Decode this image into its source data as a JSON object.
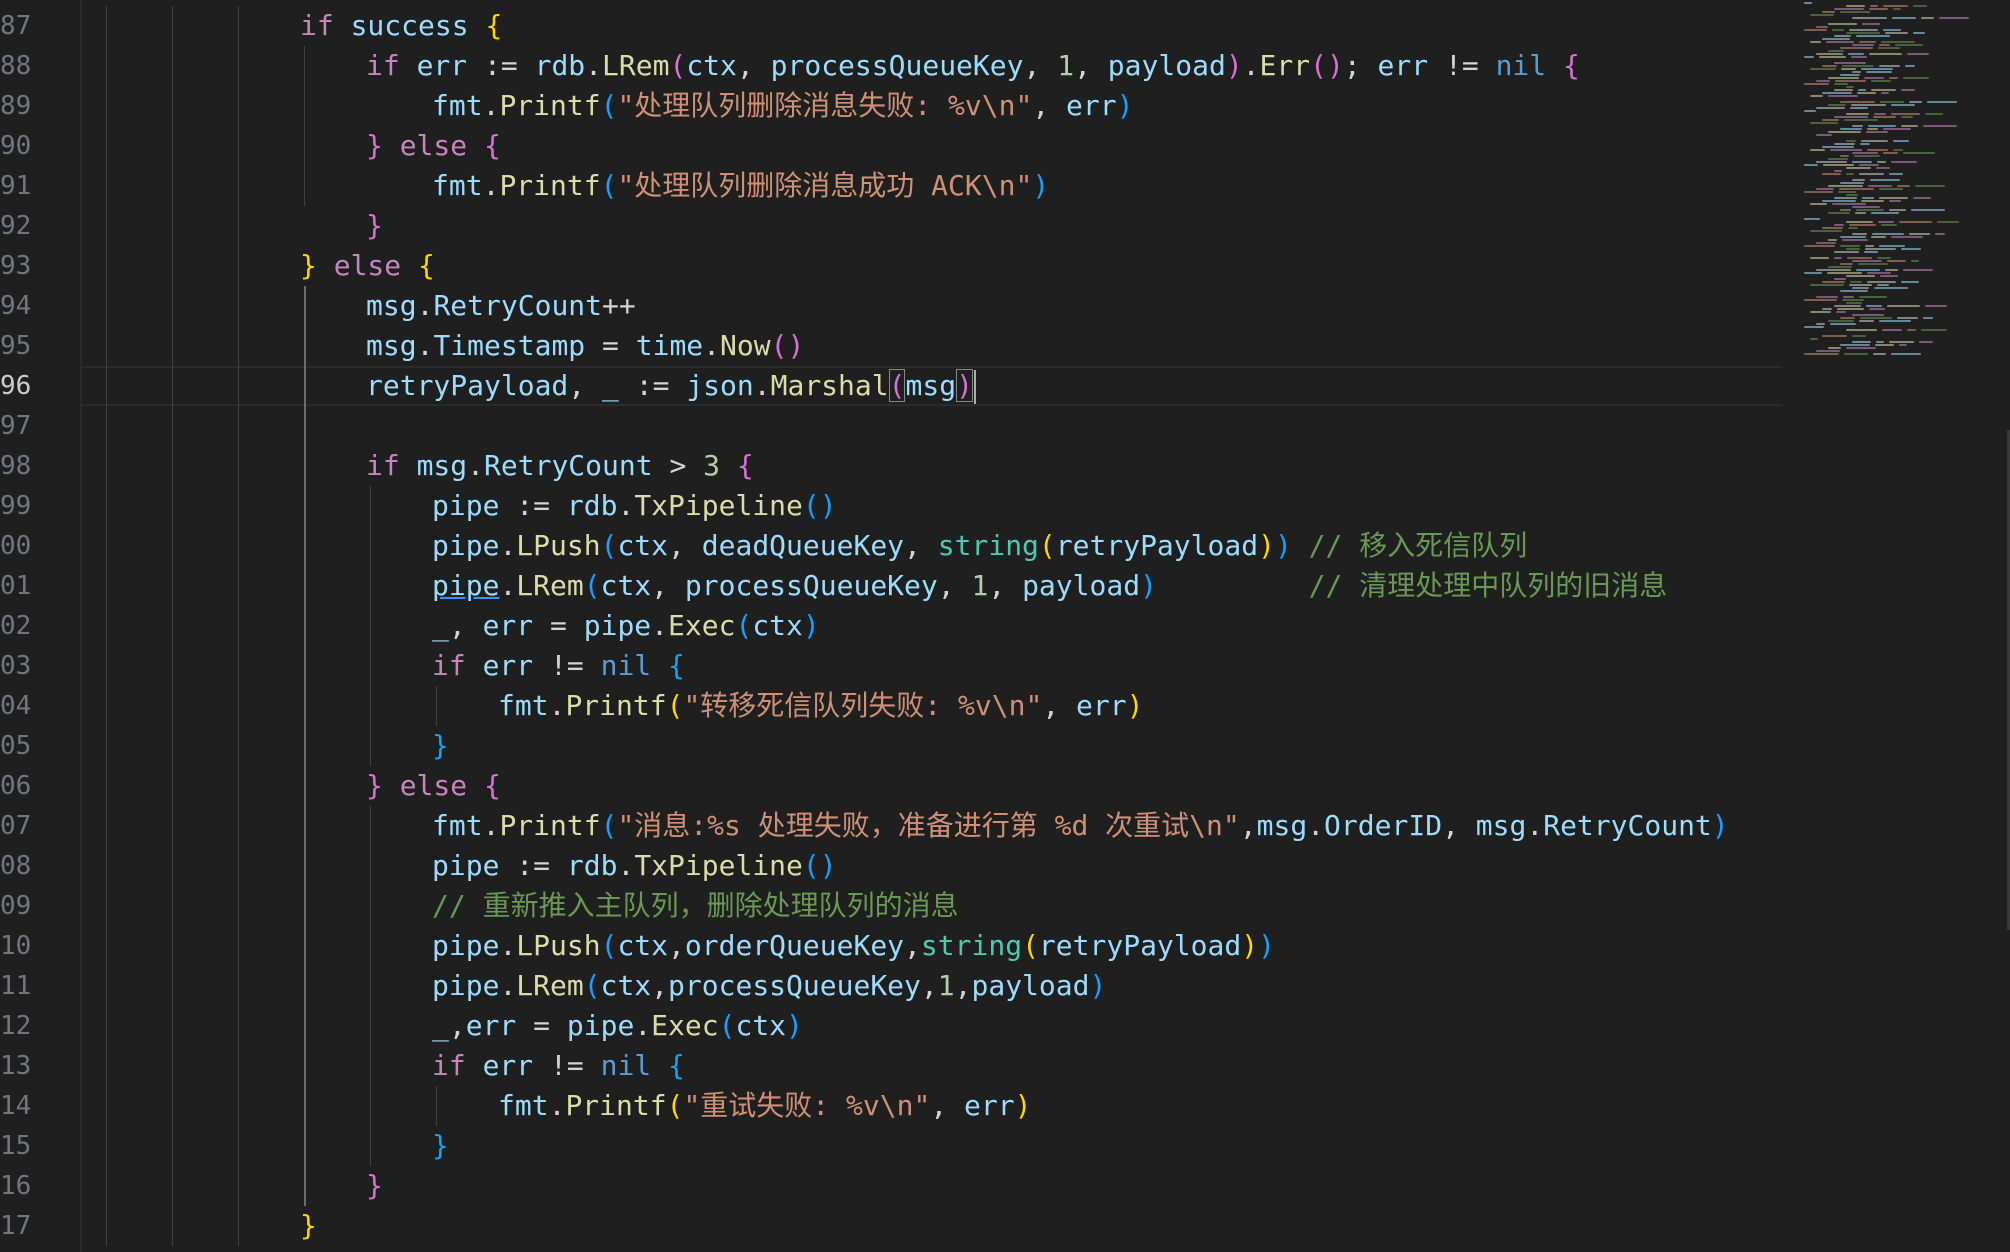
{
  "editor": {
    "active_line": "96",
    "lines": [
      {
        "n": "87",
        "indent": 3,
        "tokens": [
          {
            "t": "if",
            "c": "kw"
          },
          {
            "t": " success ",
            "c": "var"
          },
          {
            "t": "{",
            "c": "b1"
          }
        ]
      },
      {
        "n": "88",
        "indent": 4,
        "tokens": [
          {
            "t": "if",
            "c": "kw"
          },
          {
            "t": " err ",
            "c": "var"
          },
          {
            "t": ":= ",
            "c": "pl"
          },
          {
            "t": "rdb",
            "c": "var"
          },
          {
            "t": ".",
            "c": "pl"
          },
          {
            "t": "LRem",
            "c": "fn"
          },
          {
            "t": "(",
            "c": "b2"
          },
          {
            "t": "ctx",
            "c": "var"
          },
          {
            "t": ", ",
            "c": "pl"
          },
          {
            "t": "processQueueKey",
            "c": "var"
          },
          {
            "t": ", ",
            "c": "pl"
          },
          {
            "t": "1",
            "c": "num"
          },
          {
            "t": ", ",
            "c": "pl"
          },
          {
            "t": "payload",
            "c": "var"
          },
          {
            "t": ")",
            "c": "b2"
          },
          {
            "t": ".",
            "c": "pl"
          },
          {
            "t": "Err",
            "c": "fn"
          },
          {
            "t": "()",
            "c": "b2"
          },
          {
            "t": "; ",
            "c": "pl"
          },
          {
            "t": "err",
            "c": "var"
          },
          {
            "t": " != ",
            "c": "pl"
          },
          {
            "t": "nil",
            "c": "kw2"
          },
          {
            "t": " {",
            "c": "b2"
          }
        ]
      },
      {
        "n": "89",
        "indent": 5,
        "tokens": [
          {
            "t": "fmt",
            "c": "var"
          },
          {
            "t": ".",
            "c": "pl"
          },
          {
            "t": "Printf",
            "c": "fn"
          },
          {
            "t": "(",
            "c": "b3"
          },
          {
            "t": "\"处理队列删除消息失败: %v\\n\"",
            "c": "str"
          },
          {
            "t": ", ",
            "c": "pl"
          },
          {
            "t": "err",
            "c": "var"
          },
          {
            "t": ")",
            "c": "b3"
          }
        ]
      },
      {
        "n": "90",
        "indent": 4,
        "tokens": [
          {
            "t": "}",
            "c": "b2"
          },
          {
            "t": " else ",
            "c": "kw"
          },
          {
            "t": "{",
            "c": "b2"
          }
        ]
      },
      {
        "n": "91",
        "indent": 5,
        "tokens": [
          {
            "t": "fmt",
            "c": "var"
          },
          {
            "t": ".",
            "c": "pl"
          },
          {
            "t": "Printf",
            "c": "fn"
          },
          {
            "t": "(",
            "c": "b3"
          },
          {
            "t": "\"处理队列删除消息成功 ACK\\n\"",
            "c": "str"
          },
          {
            "t": ")",
            "c": "b3"
          }
        ]
      },
      {
        "n": "92",
        "indent": 4,
        "tokens": [
          {
            "t": "}",
            "c": "b2"
          }
        ]
      },
      {
        "n": "93",
        "indent": 3,
        "tokens": [
          {
            "t": "}",
            "c": "b1"
          },
          {
            "t": " else ",
            "c": "kw"
          },
          {
            "t": "{",
            "c": "b1"
          }
        ]
      },
      {
        "n": "94",
        "indent": 4,
        "tokens": [
          {
            "t": "msg",
            "c": "var"
          },
          {
            "t": ".",
            "c": "pl"
          },
          {
            "t": "RetryCount",
            "c": "var"
          },
          {
            "t": "++",
            "c": "pl"
          }
        ]
      },
      {
        "n": "95",
        "indent": 4,
        "tokens": [
          {
            "t": "msg",
            "c": "var"
          },
          {
            "t": ".",
            "c": "pl"
          },
          {
            "t": "Timestamp",
            "c": "var"
          },
          {
            "t": " = ",
            "c": "pl"
          },
          {
            "t": "time",
            "c": "var"
          },
          {
            "t": ".",
            "c": "pl"
          },
          {
            "t": "Now",
            "c": "fn"
          },
          {
            "t": "()",
            "c": "b2"
          }
        ]
      },
      {
        "n": "96",
        "indent": 4,
        "cursor": true,
        "tokens": [
          {
            "t": "retryPayload",
            "c": "var"
          },
          {
            "t": ", ",
            "c": "pl"
          },
          {
            "t": "_",
            "c": "var"
          },
          {
            "t": " := ",
            "c": "pl"
          },
          {
            "t": "json",
            "c": "var"
          },
          {
            "t": ".",
            "c": "pl"
          },
          {
            "t": "Marshal",
            "c": "fn"
          },
          {
            "t": "(",
            "c": "b2",
            "m": true
          },
          {
            "t": "msg",
            "c": "var"
          },
          {
            "t": ")",
            "c": "b2",
            "m": true
          }
        ]
      },
      {
        "n": "97",
        "indent": 0,
        "tokens": []
      },
      {
        "n": "98",
        "indent": 4,
        "tokens": [
          {
            "t": "if",
            "c": "kw"
          },
          {
            "t": " msg",
            "c": "var"
          },
          {
            "t": ".",
            "c": "pl"
          },
          {
            "t": "RetryCount",
            "c": "var"
          },
          {
            "t": " > ",
            "c": "pl"
          },
          {
            "t": "3",
            "c": "num"
          },
          {
            "t": " {",
            "c": "b2"
          }
        ]
      },
      {
        "n": "99",
        "indent": 5,
        "tokens": [
          {
            "t": "pipe",
            "c": "var"
          },
          {
            "t": " := ",
            "c": "pl"
          },
          {
            "t": "rdb",
            "c": "var"
          },
          {
            "t": ".",
            "c": "pl"
          },
          {
            "t": "TxPipeline",
            "c": "fn"
          },
          {
            "t": "()",
            "c": "b3"
          }
        ]
      },
      {
        "n": "00",
        "indent": 5,
        "tokens": [
          {
            "t": "pipe",
            "c": "var"
          },
          {
            "t": ".",
            "c": "pl"
          },
          {
            "t": "LPush",
            "c": "fn"
          },
          {
            "t": "(",
            "c": "b3"
          },
          {
            "t": "ctx",
            "c": "var"
          },
          {
            "t": ", ",
            "c": "pl"
          },
          {
            "t": "deadQueueKey",
            "c": "var"
          },
          {
            "t": ", ",
            "c": "pl"
          },
          {
            "t": "string",
            "c": "type"
          },
          {
            "t": "(",
            "c": "b1"
          },
          {
            "t": "retryPayload",
            "c": "var"
          },
          {
            "t": ")",
            "c": "b1"
          },
          {
            "t": ")",
            "c": "b3"
          },
          {
            "t": " // 移入死信队列",
            "c": "cmt"
          }
        ]
      },
      {
        "n": "01",
        "indent": 5,
        "tokens": [
          {
            "t": "pipe",
            "c": "var",
            "u": true
          },
          {
            "t": ".",
            "c": "pl"
          },
          {
            "t": "LRem",
            "c": "fn"
          },
          {
            "t": "(",
            "c": "b3"
          },
          {
            "t": "ctx",
            "c": "var"
          },
          {
            "t": ", ",
            "c": "pl"
          },
          {
            "t": "processQueueKey",
            "c": "var"
          },
          {
            "t": ", ",
            "c": "pl"
          },
          {
            "t": "1",
            "c": "num"
          },
          {
            "t": ", ",
            "c": "pl"
          },
          {
            "t": "payload",
            "c": "var"
          },
          {
            "t": ")",
            "c": "b3"
          },
          {
            "t": "         // 清理处理中队列的旧消息",
            "c": "cmt"
          }
        ]
      },
      {
        "n": "02",
        "indent": 5,
        "tokens": [
          {
            "t": "_",
            "c": "var"
          },
          {
            "t": ", ",
            "c": "pl"
          },
          {
            "t": "err",
            "c": "var"
          },
          {
            "t": " = ",
            "c": "pl"
          },
          {
            "t": "pipe",
            "c": "var"
          },
          {
            "t": ".",
            "c": "pl"
          },
          {
            "t": "Exec",
            "c": "fn"
          },
          {
            "t": "(",
            "c": "b3"
          },
          {
            "t": "ctx",
            "c": "var"
          },
          {
            "t": ")",
            "c": "b3"
          }
        ]
      },
      {
        "n": "03",
        "indent": 5,
        "tokens": [
          {
            "t": "if",
            "c": "kw"
          },
          {
            "t": " err",
            "c": "var"
          },
          {
            "t": " != ",
            "c": "pl"
          },
          {
            "t": "nil",
            "c": "kw2"
          },
          {
            "t": " {",
            "c": "b3"
          }
        ]
      },
      {
        "n": "04",
        "indent": 6,
        "tokens": [
          {
            "t": "fmt",
            "c": "var"
          },
          {
            "t": ".",
            "c": "pl"
          },
          {
            "t": "Printf",
            "c": "fn"
          },
          {
            "t": "(",
            "c": "b1"
          },
          {
            "t": "\"转移死信队列失败: %v\\n\"",
            "c": "str"
          },
          {
            "t": ", ",
            "c": "pl"
          },
          {
            "t": "err",
            "c": "var"
          },
          {
            "t": ")",
            "c": "b1"
          }
        ]
      },
      {
        "n": "05",
        "indent": 5,
        "tokens": [
          {
            "t": "}",
            "c": "b3"
          }
        ]
      },
      {
        "n": "06",
        "indent": 4,
        "tokens": [
          {
            "t": "}",
            "c": "b2"
          },
          {
            "t": " else ",
            "c": "kw"
          },
          {
            "t": "{",
            "c": "b2"
          }
        ]
      },
      {
        "n": "07",
        "indent": 5,
        "tokens": [
          {
            "t": "fmt",
            "c": "var"
          },
          {
            "t": ".",
            "c": "pl"
          },
          {
            "t": "Printf",
            "c": "fn"
          },
          {
            "t": "(",
            "c": "b3"
          },
          {
            "t": "\"消息:%s 处理失败，准备进行第 %d 次重试\\n\"",
            "c": "str"
          },
          {
            "t": ",",
            "c": "pl"
          },
          {
            "t": "msg",
            "c": "var"
          },
          {
            "t": ".",
            "c": "pl"
          },
          {
            "t": "OrderID",
            "c": "var"
          },
          {
            "t": ", ",
            "c": "pl"
          },
          {
            "t": "msg",
            "c": "var"
          },
          {
            "t": ".",
            "c": "pl"
          },
          {
            "t": "RetryCount",
            "c": "var"
          },
          {
            "t": ")",
            "c": "b3"
          }
        ]
      },
      {
        "n": "08",
        "indent": 5,
        "tokens": [
          {
            "t": "pipe",
            "c": "var"
          },
          {
            "t": " := ",
            "c": "pl"
          },
          {
            "t": "rdb",
            "c": "var"
          },
          {
            "t": ".",
            "c": "pl"
          },
          {
            "t": "TxPipeline",
            "c": "fn"
          },
          {
            "t": "()",
            "c": "b3"
          }
        ]
      },
      {
        "n": "09",
        "indent": 5,
        "tokens": [
          {
            "t": "// 重新推入主队列，删除处理队列的消息",
            "c": "cmt"
          }
        ]
      },
      {
        "n": "10",
        "indent": 5,
        "tokens": [
          {
            "t": "pipe",
            "c": "var"
          },
          {
            "t": ".",
            "c": "pl"
          },
          {
            "t": "LPush",
            "c": "fn"
          },
          {
            "t": "(",
            "c": "b3"
          },
          {
            "t": "ctx",
            "c": "var"
          },
          {
            "t": ",",
            "c": "pl"
          },
          {
            "t": "orderQueueKey",
            "c": "var"
          },
          {
            "t": ",",
            "c": "pl"
          },
          {
            "t": "string",
            "c": "type"
          },
          {
            "t": "(",
            "c": "b1"
          },
          {
            "t": "retryPayload",
            "c": "var"
          },
          {
            "t": ")",
            "c": "b1"
          },
          {
            "t": ")",
            "c": "b3"
          }
        ]
      },
      {
        "n": "11",
        "indent": 5,
        "tokens": [
          {
            "t": "pipe",
            "c": "var"
          },
          {
            "t": ".",
            "c": "pl"
          },
          {
            "t": "LRem",
            "c": "fn"
          },
          {
            "t": "(",
            "c": "b3"
          },
          {
            "t": "ctx",
            "c": "var"
          },
          {
            "t": ",",
            "c": "pl"
          },
          {
            "t": "processQueueKey",
            "c": "var"
          },
          {
            "t": ",",
            "c": "pl"
          },
          {
            "t": "1",
            "c": "num"
          },
          {
            "t": ",",
            "c": "pl"
          },
          {
            "t": "payload",
            "c": "var"
          },
          {
            "t": ")",
            "c": "b3"
          }
        ]
      },
      {
        "n": "12",
        "indent": 5,
        "tokens": [
          {
            "t": "_",
            "c": "var"
          },
          {
            "t": ",",
            "c": "pl"
          },
          {
            "t": "err",
            "c": "var"
          },
          {
            "t": " = ",
            "c": "pl"
          },
          {
            "t": "pipe",
            "c": "var"
          },
          {
            "t": ".",
            "c": "pl"
          },
          {
            "t": "Exec",
            "c": "fn"
          },
          {
            "t": "(",
            "c": "b3"
          },
          {
            "t": "ctx",
            "c": "var"
          },
          {
            "t": ")",
            "c": "b3"
          }
        ]
      },
      {
        "n": "13",
        "indent": 5,
        "tokens": [
          {
            "t": "if",
            "c": "kw"
          },
          {
            "t": " err",
            "c": "var"
          },
          {
            "t": " != ",
            "c": "pl"
          },
          {
            "t": "nil",
            "c": "kw2"
          },
          {
            "t": " {",
            "c": "b3"
          }
        ]
      },
      {
        "n": "14",
        "indent": 6,
        "tokens": [
          {
            "t": "fmt",
            "c": "var"
          },
          {
            "t": ".",
            "c": "pl"
          },
          {
            "t": "Printf",
            "c": "fn"
          },
          {
            "t": "(",
            "c": "b1"
          },
          {
            "t": "\"重试失败: %v\\n\"",
            "c": "str"
          },
          {
            "t": ", ",
            "c": "pl"
          },
          {
            "t": "err",
            "c": "var"
          },
          {
            "t": ")",
            "c": "b1"
          }
        ]
      },
      {
        "n": "15",
        "indent": 5,
        "tokens": [
          {
            "t": "}",
            "c": "b3"
          }
        ]
      },
      {
        "n": "16",
        "indent": 4,
        "tokens": [
          {
            "t": "}",
            "c": "b2"
          }
        ]
      },
      {
        "n": "17",
        "indent": 3,
        "tokens": [
          {
            "t": "}",
            "c": "b1"
          }
        ]
      }
    ]
  },
  "colors": {
    "background": "#1f1f1f",
    "keyword": "#c586c0",
    "variable": "#9cdcfe",
    "function": "#dcdcaa",
    "string": "#ce9178",
    "comment": "#6a9955",
    "bracket_1": "#ffd700",
    "bracket_2": "#da70d6",
    "bracket_3": "#179fff"
  }
}
